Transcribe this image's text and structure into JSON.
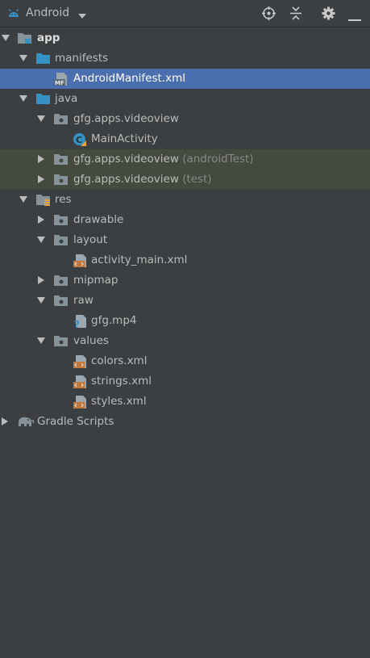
{
  "toolbar": {
    "view_name": "Android",
    "icons": [
      "locate-icon",
      "collapse-all-icon",
      "gear-icon",
      "minimize-icon"
    ]
  },
  "tree": {
    "app": "app",
    "manifests": "manifests",
    "manifest_file": "AndroidManifest.xml",
    "java": "java",
    "package_main": "gfg.apps.videoview",
    "main_activity": "MainActivity",
    "package_android_test": "gfg.apps.videoview",
    "android_test_suffix": "(androidTest)",
    "package_test": "gfg.apps.videoview",
    "test_suffix": "(test)",
    "res": "res",
    "drawable": "drawable",
    "layout": "layout",
    "activity_main": "activity_main.xml",
    "mipmap": "mipmap",
    "raw": "raw",
    "gfg_video": "gfg.mp4",
    "values": "values",
    "colors": "colors.xml",
    "strings": "strings.xml",
    "styles": "styles.xml",
    "gradle_scripts": "Gradle Scripts"
  },
  "colors": {
    "background": "#3c3f41",
    "selected": "#4b6eaf",
    "test_tint": "#444a3d",
    "folder": "#87939a",
    "module_folder": "#3592c4"
  }
}
